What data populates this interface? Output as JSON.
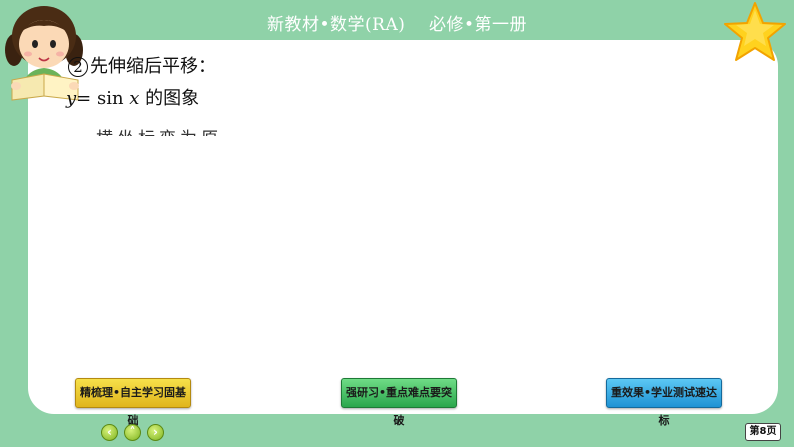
{
  "header": {
    "title": "新教材•数学(RA)    必修•第一册"
  },
  "content": {
    "step_number": "2",
    "step_text": "先伸缩后平移：",
    "func_prefix": "y",
    "func_eq": "= sin ",
    "func_var": "x",
    "func_suffix": " 的图象",
    "partial_line": "横坐标变为原"
  },
  "nav": {
    "btn1": "精梳理•自主学习固基础",
    "btn2": "强研习•重点难点要突破",
    "btn3": "重效果•学业测试速达标"
  },
  "controls": {
    "prev": "‹",
    "home": "˄",
    "next": "›"
  },
  "page": {
    "label": "第8页"
  },
  "colors": {
    "background": "#8fd2a8",
    "btn1": "#f6e04a",
    "btn2": "#4cc46a",
    "btn3": "#3ab0e6",
    "star": "#ffd21e"
  },
  "icons": {
    "mascot": "reading-girl-illustration",
    "star": "star-icon"
  }
}
